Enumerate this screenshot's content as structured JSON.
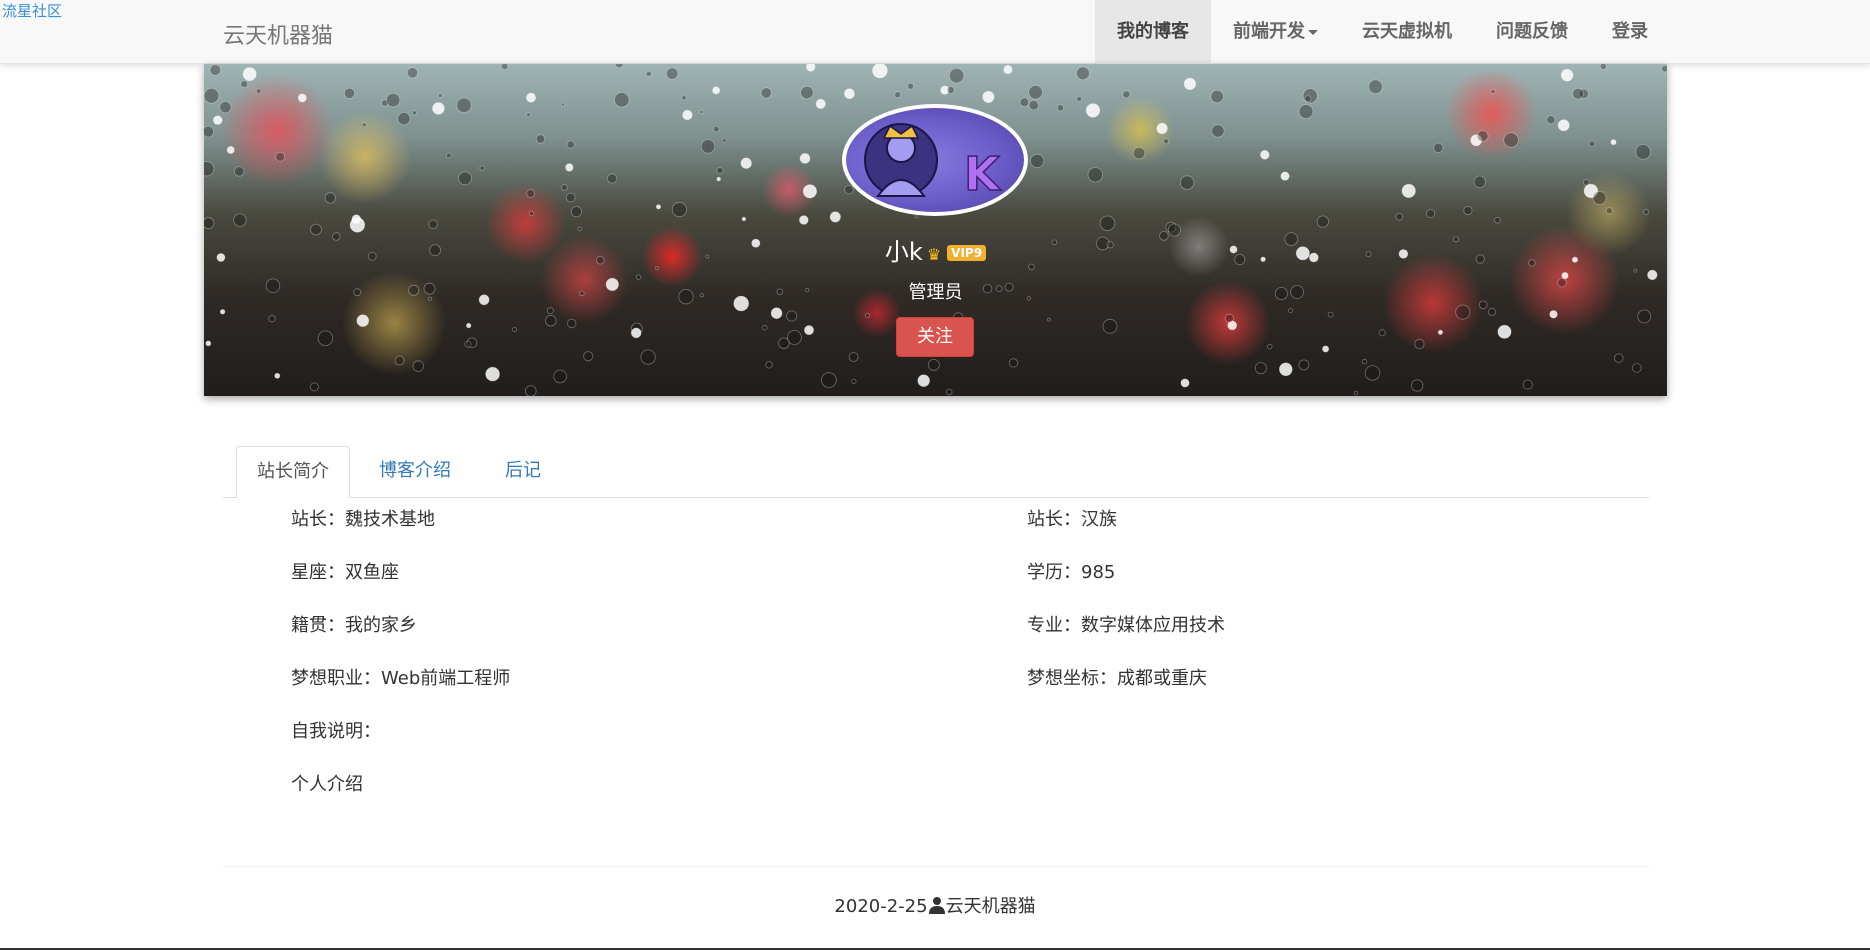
{
  "corner_link": "流星社区",
  "navbar": {
    "brand": "云天机器猫",
    "items": [
      {
        "label": "我的博客",
        "active": true
      },
      {
        "label": "前端开发",
        "dropdown": true
      },
      {
        "label": "云天虚拟机"
      },
      {
        "label": "问题反馈"
      },
      {
        "label": "登录"
      }
    ]
  },
  "profile": {
    "name": "小k",
    "vip_badge": "VIP9",
    "role": "管理员",
    "follow_label": "关注",
    "avatar_text": "K"
  },
  "tabs": [
    {
      "label": "站长简介",
      "active": true
    },
    {
      "label": "博客介绍"
    },
    {
      "label": "后记"
    }
  ],
  "info": {
    "left": [
      "站长：魏技术基地",
      "星座：双鱼座",
      "籍贯：我的家乡",
      "梦想职业：Web前端工程师",
      "自我说明：",
      "个人介绍"
    ],
    "right": [
      "站长：汉族",
      "学历：985",
      "专业：数字媒体应用技术",
      "梦想坐标：成都或重庆"
    ]
  },
  "footer": {
    "date": "2020-2-25",
    "author": "云天机器猫"
  },
  "colors": {
    "follow_button": "#d9534f",
    "tab_link": "#337ab7",
    "corner_link": "#3a8fd6"
  }
}
